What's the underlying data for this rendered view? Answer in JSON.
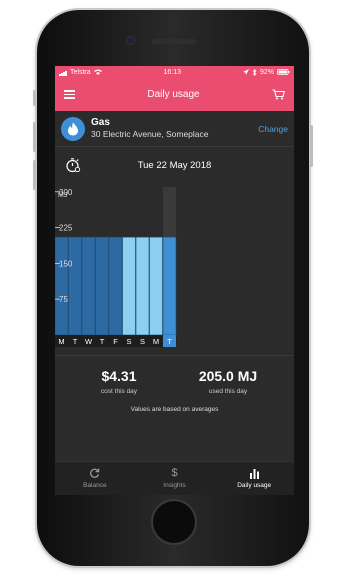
{
  "status_bar": {
    "carrier": "Telstra",
    "time": "16:13",
    "battery": "92%"
  },
  "header": {
    "title": "Daily usage"
  },
  "account": {
    "fuel": "Gas",
    "address": "30 Electric Avenue, Someplace",
    "change_label": "Change"
  },
  "date_label": "Tue 22 May 2018",
  "chart_data": {
    "type": "bar",
    "unit_label": "MJ",
    "ylim": [
      0,
      310
    ],
    "y_ticks": [
      {
        "value": 300,
        "label": "300"
      },
      {
        "value": 225,
        "label": "225"
      },
      {
        "value": 150,
        "label": "150"
      },
      {
        "value": 75,
        "label": "75"
      }
    ],
    "categories": [
      "M",
      "T",
      "W",
      "T",
      "F",
      "S",
      "S",
      "M",
      "T"
    ],
    "values": [
      205,
      205,
      205,
      205,
      205,
      205,
      205,
      205,
      205
    ],
    "selected_index": 8,
    "colors": {
      "weekday": "#2d6aa3",
      "weekend": "#8ccff0",
      "selected": "#3f8fd4",
      "highlight": "#3a3a3a"
    }
  },
  "stats": {
    "cost_value": "$4.31",
    "cost_label": "cost this day",
    "usage_value": "205.0 MJ",
    "usage_label": "used this day",
    "note": "Values are based on averages"
  },
  "tabs": [
    {
      "label": "Balance",
      "icon": "refresh-icon"
    },
    {
      "label": "Insights",
      "icon": "dollar-icon"
    },
    {
      "label": "Daily usage",
      "icon": "bar-chart-icon",
      "active": true
    }
  ],
  "colors": {
    "accent": "#ea4d6f",
    "link": "#4aa3df"
  }
}
